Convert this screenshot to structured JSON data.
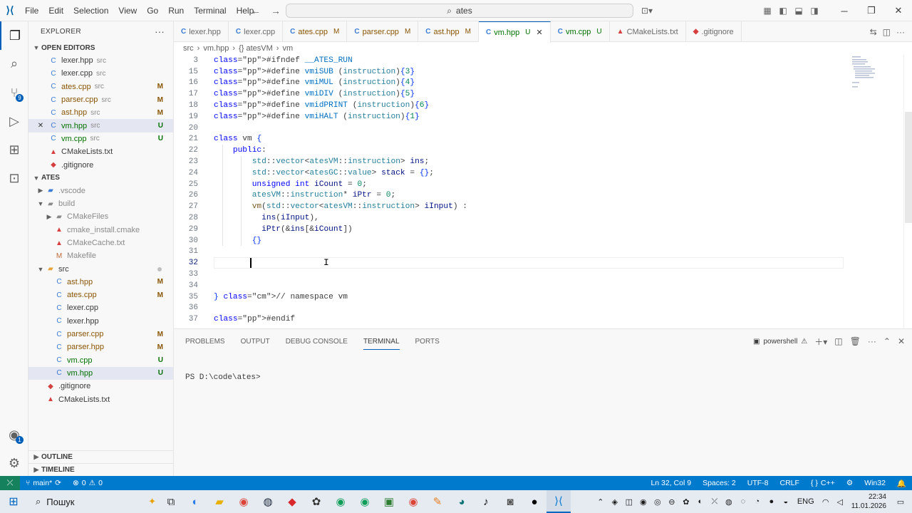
{
  "titlebar": {
    "menu": [
      "File",
      "Edit",
      "Selection",
      "View",
      "Go",
      "Run",
      "Terminal",
      "Help"
    ],
    "search": "ates"
  },
  "activity": {
    "scm_badge": "9",
    "accounts_badge": "1"
  },
  "sidebar": {
    "title": "EXPLORER",
    "open_editors_label": "OPEN EDITORS",
    "open_editors": [
      {
        "name": "lexer.hpp",
        "path": "src",
        "status": "",
        "icon": "C"
      },
      {
        "name": "lexer.cpp",
        "path": "src",
        "status": "",
        "icon": "C"
      },
      {
        "name": "ates.cpp",
        "path": "src",
        "status": "M",
        "icon": "C"
      },
      {
        "name": "parser.cpp",
        "path": "src",
        "status": "M",
        "icon": "C"
      },
      {
        "name": "ast.hpp",
        "path": "src",
        "status": "M",
        "icon": "C"
      },
      {
        "name": "vm.hpp",
        "path": "src",
        "status": "U",
        "icon": "C"
      },
      {
        "name": "vm.cpp",
        "path": "src",
        "status": "U",
        "icon": "C"
      },
      {
        "name": "CMakeLists.txt",
        "path": "",
        "status": "",
        "icon": "▲"
      },
      {
        "name": ".gitignore",
        "path": "",
        "status": "",
        "icon": "◆"
      }
    ],
    "project_label": "ATES",
    "tree": [
      {
        "name": ".vscode",
        "kind": "folder-closed",
        "depth": 1
      },
      {
        "name": "build",
        "kind": "folder-open",
        "depth": 1
      },
      {
        "name": "CMakeFiles",
        "kind": "folder-closed",
        "depth": 2
      },
      {
        "name": "cmake_install.cmake",
        "kind": "file",
        "depth": 2
      },
      {
        "name": "CMakeCache.txt",
        "kind": "file",
        "depth": 2
      },
      {
        "name": "Makefile",
        "kind": "file",
        "depth": 2
      },
      {
        "name": "src",
        "kind": "folder-open",
        "depth": 1
      },
      {
        "name": "ast.hpp",
        "kind": "file",
        "depth": 2,
        "status": "M"
      },
      {
        "name": "ates.cpp",
        "kind": "file",
        "depth": 2,
        "status": "M"
      },
      {
        "name": "lexer.cpp",
        "kind": "file",
        "depth": 2,
        "status": ""
      },
      {
        "name": "lexer.hpp",
        "kind": "file",
        "depth": 2,
        "status": ""
      },
      {
        "name": "parser.cpp",
        "kind": "file",
        "depth": 2,
        "status": "M"
      },
      {
        "name": "parser.hpp",
        "kind": "file",
        "depth": 2,
        "status": "M"
      },
      {
        "name": "vm.cpp",
        "kind": "file",
        "depth": 2,
        "status": "U"
      },
      {
        "name": "vm.hpp",
        "kind": "file",
        "depth": 2,
        "status": "U"
      },
      {
        "name": ".gitignore",
        "kind": "file",
        "depth": 1,
        "status": ""
      },
      {
        "name": "CMakeLists.txt",
        "kind": "file",
        "depth": 1,
        "status": ""
      }
    ],
    "outline_label": "OUTLINE",
    "timeline_label": "TIMELINE"
  },
  "tabs": [
    {
      "name": "lexer.hpp",
      "status": ""
    },
    {
      "name": "lexer.cpp",
      "status": ""
    },
    {
      "name": "ates.cpp",
      "status": "M"
    },
    {
      "name": "parser.cpp",
      "status": "M"
    },
    {
      "name": "ast.hpp",
      "status": "M"
    },
    {
      "name": "vm.hpp",
      "status": "U",
      "close": "✕"
    },
    {
      "name": "vm.cpp",
      "status": "U"
    },
    {
      "name": "CMakeLists.txt",
      "status": ""
    },
    {
      "name": ".gitignore",
      "status": ""
    }
  ],
  "breadcrumb": [
    "src",
    "vm.hpp",
    "{} atesVM",
    "vm"
  ],
  "editor": {
    "lines": [
      {
        "n": "3",
        "text": "#ifndef __ATES_RUN"
      },
      {
        "n": "15",
        "text": "#define vmiSUB (instruction){3}"
      },
      {
        "n": "16",
        "text": "#define vmiMUL (instruction){4}"
      },
      {
        "n": "17",
        "text": "#define vmiDIV (instruction){5}"
      },
      {
        "n": "18",
        "text": "#define vmidPRINT (instruction){6}"
      },
      {
        "n": "19",
        "text": "#define vmiHALT (instruction){1}"
      },
      {
        "n": "20",
        "text": ""
      },
      {
        "n": "21",
        "text": "class vm {"
      },
      {
        "n": "22",
        "text": "    public:"
      },
      {
        "n": "23",
        "text": "        std::vector<atesVM::instruction> ins;"
      },
      {
        "n": "24",
        "text": "        std::vector<atesGC::value> stack = {};"
      },
      {
        "n": "25",
        "text": "        unsigned int iCount = 0;"
      },
      {
        "n": "26",
        "text": "        atesVM::instruction* iPtr = 0;"
      },
      {
        "n": "27",
        "text": "        vm(std::vector<atesVM::instruction> iInput) :"
      },
      {
        "n": "28",
        "text": "          ins(iInput),"
      },
      {
        "n": "29",
        "text": "          iPtr(&ins[&iCount])"
      },
      {
        "n": "30",
        "text": "        {}"
      },
      {
        "n": "31",
        "text": ""
      },
      {
        "n": "32",
        "text": ""
      },
      {
        "n": "33",
        "text": ""
      },
      {
        "n": "34",
        "text": ""
      },
      {
        "n": "35",
        "text": "} // namespace vm"
      },
      {
        "n": "36",
        "text": ""
      },
      {
        "n": "37",
        "text": "#endif"
      }
    ],
    "current_line": "32"
  },
  "panel": {
    "tabs": [
      "PROBLEMS",
      "OUTPUT",
      "DEBUG CONSOLE",
      "TERMINAL",
      "PORTS"
    ],
    "active_tab": "TERMINAL",
    "shell": "powershell",
    "prompt": "PS D:\\code\\ates>"
  },
  "statusbar": {
    "branch": "main*",
    "errors": "0",
    "warnings": "0",
    "position": "Ln 32, Col 9",
    "spaces": "Spaces: 2",
    "encoding": "UTF-8",
    "eol": "CRLF",
    "language": "C++",
    "platform": "Win32"
  },
  "taskbar": {
    "search": "Пошук",
    "lang": "ENG",
    "time": "22:34",
    "date": "11.01.2026"
  },
  "colors": {
    "accent": "#005fb8",
    "statusbar": "#007acc",
    "modified": "#895503",
    "untracked": "#007100"
  }
}
